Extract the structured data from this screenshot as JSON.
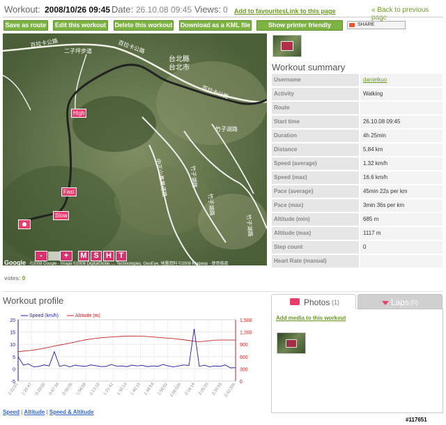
{
  "header": {
    "workout_label": "Workout:",
    "workout_value": "2008/10/26 09:45",
    "date_label": "Date:",
    "date_value": "26.10.08 09:45",
    "views_label": "Views:",
    "views_value": "0",
    "add_favourites": "Add to favourites",
    "link_page": "Link to this page",
    "back_link": "« Back to previous page"
  },
  "actions": {
    "save_route": "Save as route",
    "edit": "Edit this workout",
    "delete": "Delete this workout",
    "download_kml": "Download as a KML file",
    "printer": "Show printer friendly version",
    "share": "SHARE"
  },
  "map": {
    "markers": [
      "High",
      "Fast",
      "Slow"
    ],
    "controls": [
      "-",
      "+",
      "M",
      "S",
      "H",
      "T"
    ],
    "attribution": "©2008 Google · Image ©2008 DigitalGlobe, ... Technologies, GeoEye, 地圖資料 ©2008 Kingway · 使用條款",
    "google": "Google",
    "place_labels": [
      "台北縣",
      "台北市",
      "百拉卡公路",
      "百拉卡公路",
      "百拉卡公路",
      "中正山產業道路",
      "竹子湖路",
      "竹子湖路",
      "竹子湖路",
      "竹子湖路",
      "二子坪步道"
    ]
  },
  "summary": {
    "title": "Workout summary",
    "rows": [
      {
        "k": "Username",
        "v": "danielkuo"
      },
      {
        "k": "Activity",
        "v": "Walking"
      },
      {
        "k": "Route",
        "v": ""
      },
      {
        "k": "Start time",
        "v": "26.10.08 09:45"
      },
      {
        "k": "Duration",
        "v": "4h 25min"
      },
      {
        "k": "Distance",
        "v": "5.84 km"
      },
      {
        "k": "Speed (average)",
        "v": "1.32 km/h"
      },
      {
        "k": "Speed (max)",
        "v": "16.6 km/h"
      },
      {
        "k": "Pace (average)",
        "v": "45min 22s per km"
      },
      {
        "k": "Pace (max)",
        "v": "3min 36s per km"
      },
      {
        "k": "Altitude (min)",
        "v": "685 m"
      },
      {
        "k": "Altitude (max)",
        "v": "1117 m"
      },
      {
        "k": "Step count",
        "v": "0"
      },
      {
        "k": "Heart Rate (manual)",
        "v": ""
      }
    ]
  },
  "votes": {
    "label": "votes:",
    "value": "0"
  },
  "profile": {
    "title": "Workout profile",
    "links": [
      "Speed",
      "Altitude",
      "Speed & Altitude"
    ]
  },
  "media": {
    "photos_label": "Photos",
    "photos_count": "(1)",
    "laps_label": "Laps",
    "laps_count": "(0)",
    "add_media": "Add media to this workout"
  },
  "watermark": "#117651",
  "colors": {
    "accent": "#7cb342",
    "speed": "#1a1aaa",
    "altitude": "#cc2222",
    "marker": "#e83e6b"
  },
  "chart_data": {
    "type": "line",
    "x": [
      "0:00:00",
      "0:04:00",
      "0:08:00",
      "0:12:00",
      "0:16:00",
      "0:20:00",
      "0:24:00",
      "0:28:00",
      "0:32:00",
      "0:36:00",
      "0:40:00",
      "0:44:00",
      "0:48:00",
      "0:52:00",
      "0:56:00",
      "1:00:00",
      "1:04:00",
      "1:08:00",
      "1:12:00",
      "1:16:00",
      "1:20:00",
      "1:24:00",
      "1:28:00",
      "1:32:00",
      "1:36:00",
      "1:40:00",
      "1:44:00",
      "1:48:00",
      "1:52:00",
      "1:56:00",
      "2:00:00",
      "2:04:00",
      "2:08:00",
      "2:12:00",
      "2:16:00",
      "2:20:00",
      "2:24:00",
      "2:28:00",
      "2:32:00",
      "2:36:00",
      "2:40:00",
      "2:44:00",
      "2:48:00"
    ],
    "series": [
      {
        "name": "Speed (km/h)",
        "axis": "left",
        "color": "#1a1aaa",
        "values": [
          5,
          1.5,
          2,
          0.8,
          1,
          1.6,
          1.2,
          7,
          1,
          1.5,
          0.8,
          1.5,
          1.2,
          1,
          1.6,
          1.3,
          0.9,
          1,
          1.8,
          1.1,
          1.2,
          0.9,
          1.5,
          1.2,
          1.4,
          0.9,
          1.2,
          1,
          1.8,
          1.2,
          0.8,
          1.2,
          1.6,
          1.4,
          16.3,
          1,
          1.5,
          0.8,
          1.2,
          1,
          1.6,
          0.4,
          0.5
        ]
      },
      {
        "name": "Altitude (m)",
        "axis": "right",
        "color": "#cc2222",
        "values": [
          720,
          735,
          745,
          760,
          780,
          805,
          830,
          860,
          880,
          905,
          930,
          955,
          985,
          1010,
          1030,
          1045,
          1060,
          1070,
          1080,
          1088,
          1095,
          1100,
          1102,
          1100,
          1098,
          1090,
          1080,
          1070,
          1060,
          1050,
          1040,
          1025,
          1010,
          995,
          975,
          965,
          975,
          990,
          1000,
          1005,
          1005,
          1005,
          1005
        ]
      }
    ],
    "xlabel": "",
    "ylim_left": [
      -5,
      20
    ],
    "ylim_right": [
      0,
      1500
    ],
    "yticks_left": [
      -5,
      0,
      5,
      10,
      15,
      20
    ],
    "yticks_right": [
      0,
      300,
      600,
      900,
      1200,
      1500
    ],
    "yticks_right_labels": [
      "0",
      "300",
      "600",
      "900",
      "1,200",
      "1,500"
    ],
    "xtick_labels": [
      "1:22:01",
      "1:20:47",
      "0:29:00",
      "0:47:34",
      "0:56:05",
      "1:04:58",
      "1:13:10",
      "1:21:42",
      "1:30:14",
      "1:40:15",
      "1:48:54",
      "1:58:02",
      "2:06:50h",
      "2:16:14",
      "2:25:20",
      "2:33:55",
      "2:42:30h"
    ],
    "grid": true,
    "legend": "top-left"
  }
}
